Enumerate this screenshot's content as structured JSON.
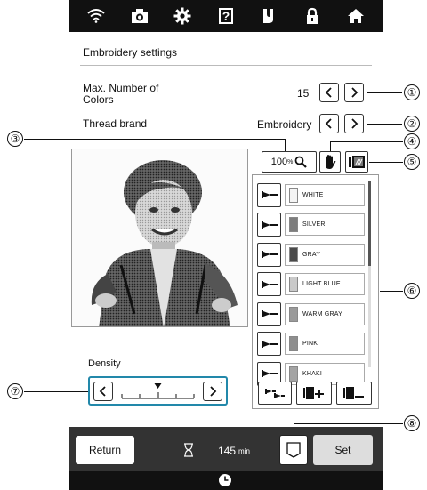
{
  "top_bar": {
    "icons": [
      "wifi-icon",
      "camera-icon",
      "gear-icon",
      "help-icon",
      "embroidery-foot-icon",
      "lock-icon",
      "home-icon"
    ],
    "help_label": "?"
  },
  "panel": {
    "title": "Embroidery settings",
    "max_colors": {
      "label": "Max. Number of Colors",
      "value": "15"
    },
    "thread_brand": {
      "label": "Thread brand",
      "value": "Embroidery"
    },
    "zoom": {
      "value": "100",
      "unit": "%"
    }
  },
  "threads": [
    {
      "name": "WHITE",
      "color": "#f4f4f4"
    },
    {
      "name": "SILVER",
      "color": "#7d7d7d"
    },
    {
      "name": "GRAY",
      "color": "#4a4a4a"
    },
    {
      "name": "LIGHT BLUE",
      "color": "#c9c9c9"
    },
    {
      "name": "WARM GRAY",
      "color": "#9a9a9a"
    },
    {
      "name": "PINK",
      "color": "#8e8e8e"
    },
    {
      "name": "KHAKI",
      "color": "#a3a3a3"
    }
  ],
  "density": {
    "label": "Density",
    "level": 0.5
  },
  "bottom_bar": {
    "return_label": "Return",
    "time_value": "145",
    "time_unit": "min",
    "set_label": "Set"
  },
  "callouts": [
    "①",
    "②",
    "③",
    "④",
    "⑤",
    "⑥",
    "⑦",
    "⑧"
  ]
}
